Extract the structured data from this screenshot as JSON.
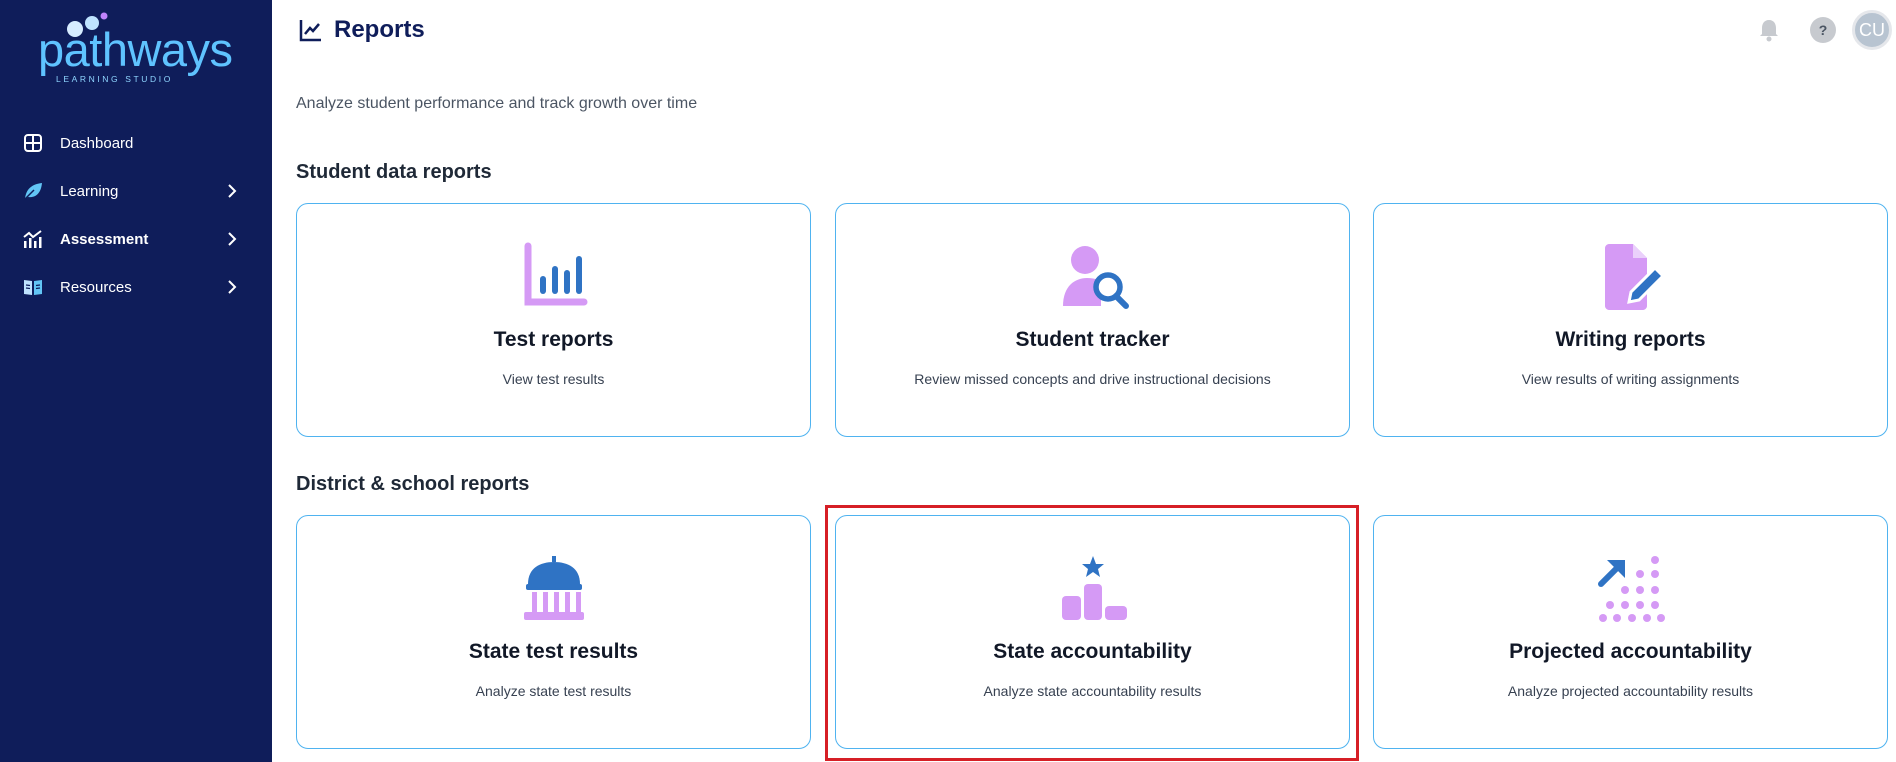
{
  "logo": {
    "word": "pathways",
    "subtitle": "LEARNING STUDIO"
  },
  "sidebar": {
    "items": [
      {
        "label": "Dashboard",
        "icon": "dashboard-grid-icon",
        "has_chevron": false
      },
      {
        "label": "Learning",
        "icon": "leaf-icon",
        "has_chevron": true
      },
      {
        "label": "Assessment",
        "icon": "analytics-chart-icon",
        "has_chevron": true,
        "active": true
      },
      {
        "label": "Resources",
        "icon": "book-icon",
        "has_chevron": true
      }
    ]
  },
  "header": {
    "title": "Reports",
    "title_icon": "line-chart-icon",
    "help_label": "?",
    "avatar_initials": "CU"
  },
  "page": {
    "subtitle": "Analyze student performance and track growth over time"
  },
  "sections": [
    {
      "title": "Student data reports",
      "cards": [
        {
          "title": "Test reports",
          "description": "View test results",
          "icon": "bar-chart-icon"
        },
        {
          "title": "Student tracker",
          "description": "Review missed concepts and drive instructional decisions",
          "icon": "user-search-icon"
        },
        {
          "title": "Writing reports",
          "description": "View results of writing assignments",
          "icon": "document-edit-icon"
        }
      ]
    },
    {
      "title": "District & school reports",
      "cards": [
        {
          "title": "State test results",
          "description": "Analyze state test results",
          "icon": "capitol-building-icon"
        },
        {
          "title": "State accountability",
          "description": "Analyze state accountability results",
          "icon": "podium-star-icon"
        },
        {
          "title": "Projected accountability",
          "description": "Analyze projected accountability results",
          "icon": "projection-arrow-icon"
        }
      ]
    }
  ],
  "colors": {
    "sidebar_bg": "#0f1d5a",
    "accent_blue": "#2f73c4",
    "accent_purple": "#d59af5",
    "card_border": "#4fb3f0",
    "highlight": "#d61f26"
  }
}
